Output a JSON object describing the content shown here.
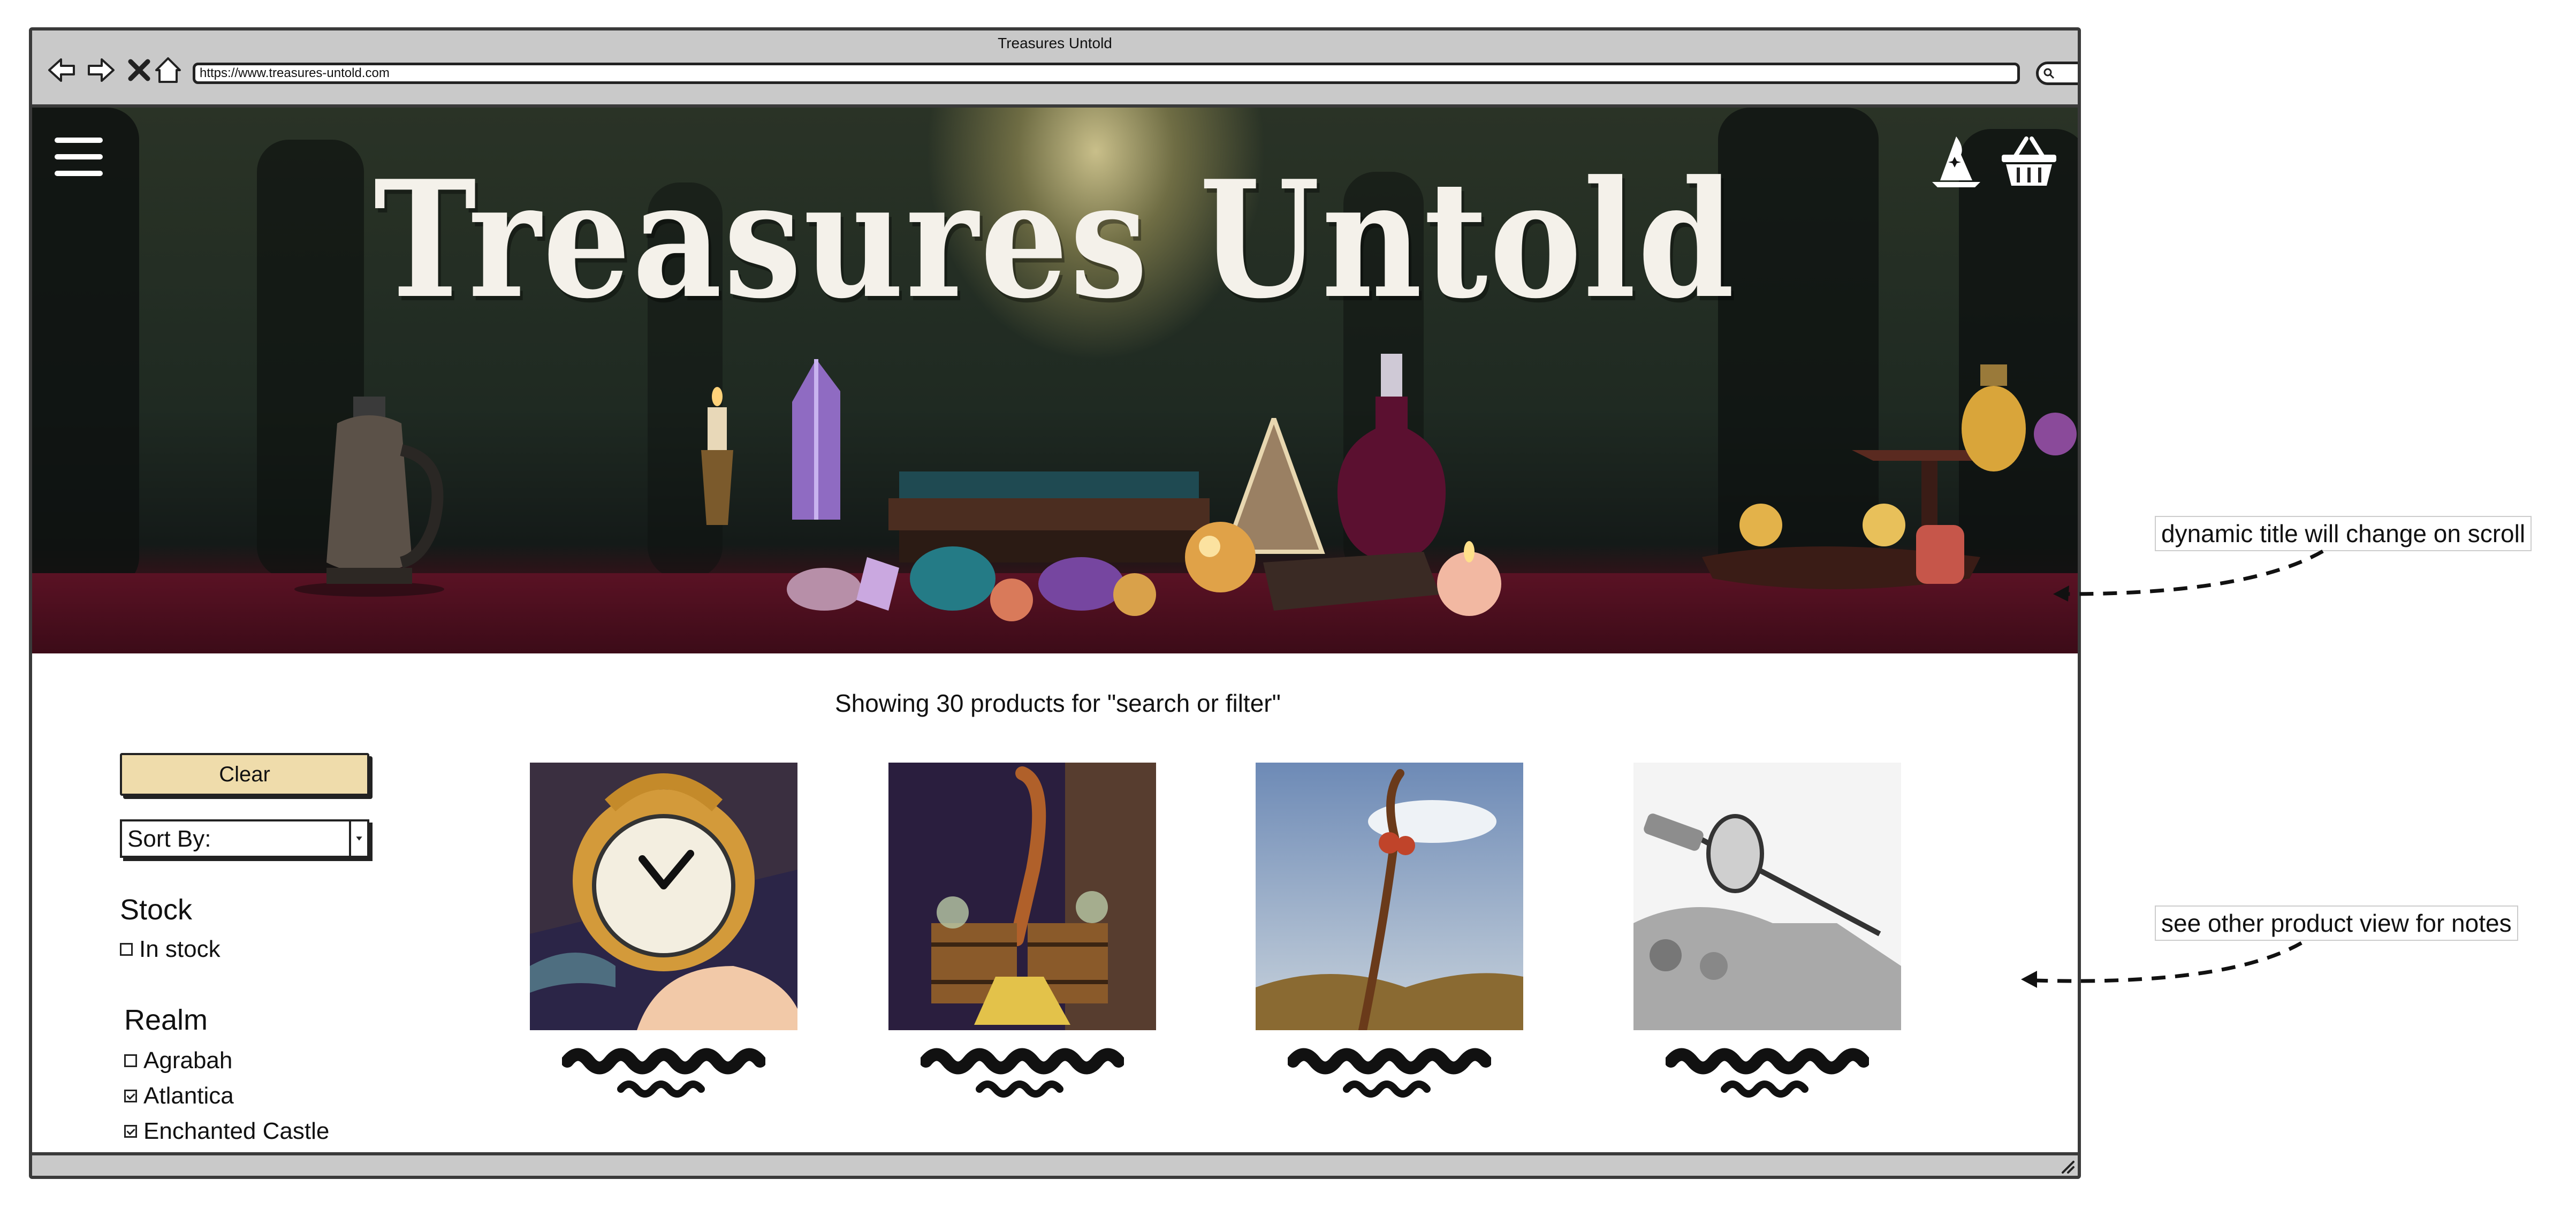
{
  "window": {
    "title": "Treasures Untold",
    "url": "https://www.treasures-untold.com"
  },
  "hero": {
    "title": "Treasures Untold"
  },
  "results": {
    "summary": "Showing 30 products for \"search or filter\""
  },
  "sidebar": {
    "clear_label": "Clear",
    "sort_label": "Sort By:",
    "stock": {
      "heading": "Stock",
      "options": [
        {
          "label": "In stock",
          "checked": false
        }
      ]
    },
    "realm": {
      "heading": "Realm",
      "options": [
        {
          "label": "Agrabah",
          "checked": false
        },
        {
          "label": "Atlantica",
          "checked": true
        },
        {
          "label": "Enchanted Castle",
          "checked": true
        }
      ]
    }
  },
  "products": [
    {
      "image": "alarm-clock"
    },
    {
      "image": "enchanted-broom-buckets"
    },
    {
      "image": "wooden-staff"
    },
    {
      "image": "sword-sketch"
    }
  ],
  "annotations": {
    "hero_note": "dynamic title will change on scroll",
    "product_note": "see other product view for notes"
  },
  "colors": {
    "clear_button": "#efdcab",
    "chrome": "#c9c9c9",
    "table_top": "#5a1224"
  }
}
